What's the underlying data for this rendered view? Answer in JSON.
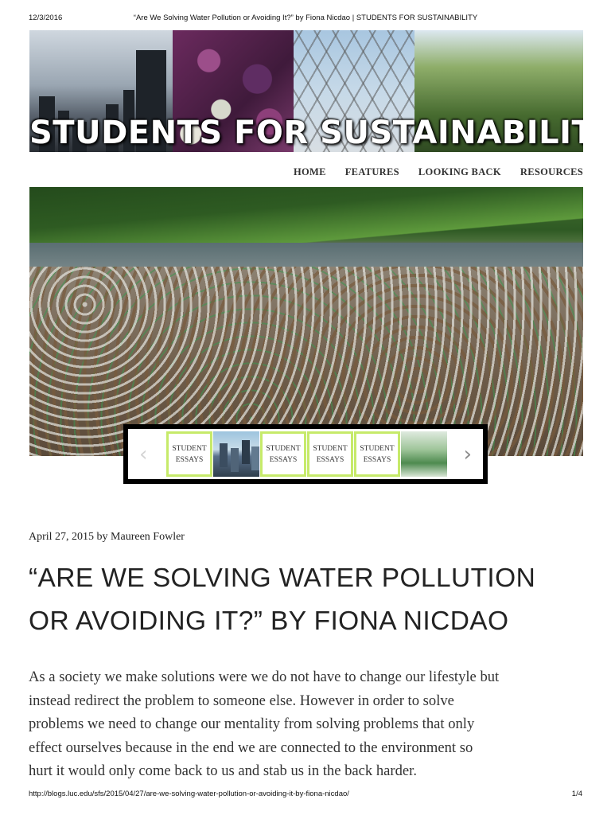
{
  "print_header": {
    "date": "12/3/2016",
    "title": "“Are We Solving Water Pollution or Avoiding It?” by Fiona Nicdao | STUDENTS FOR SUSTAINABILITY"
  },
  "site": {
    "banner_title": "STUDENTS FOR SUSTAINABILITY"
  },
  "nav": {
    "items": [
      {
        "label": "HOME"
      },
      {
        "label": "FEATURES"
      },
      {
        "label": "LOOKING BACK"
      },
      {
        "label": "RESOURCES"
      }
    ]
  },
  "carousel": {
    "prev_icon": "chevron-left-icon",
    "next_icon": "chevron-right-icon",
    "slides": [
      {
        "line1": "STUDENT",
        "line2": "ESSAYS"
      },
      {
        "image": "city-skyline"
      },
      {
        "line1": "STUDENT",
        "line2": "ESSAYS"
      },
      {
        "line1": "STUDENT",
        "line2": "ESSAYS"
      },
      {
        "line1": "STUDENT",
        "line2": "ESSAYS"
      },
      {
        "image": "greenhouse-lab"
      }
    ]
  },
  "post": {
    "meta": "April 27, 2015 by Maureen Fowler",
    "title_line1": "“ARE WE SOLVING WATER POLLUTION",
    "title_line2": "OR AVOIDING IT?” BY FIONA NICDAO",
    "body_lines": [
      "As a society we make solutions were we do not have to change our lifestyle but",
      "instead redirect the problem to someone else. However in order to solve",
      "problems we need to change our mentality from solving problems that only",
      "effect ourselves because in the end we are connected to the environment so",
      "hurt it would only come back to us and stab us in the back harder."
    ]
  },
  "print_footer": {
    "url": "http://blogs.luc.edu/sfs/2015/04/27/are-we-solving-water-pollution-or-avoiding-it-by-fiona-nicdao/",
    "page": "1/4"
  }
}
